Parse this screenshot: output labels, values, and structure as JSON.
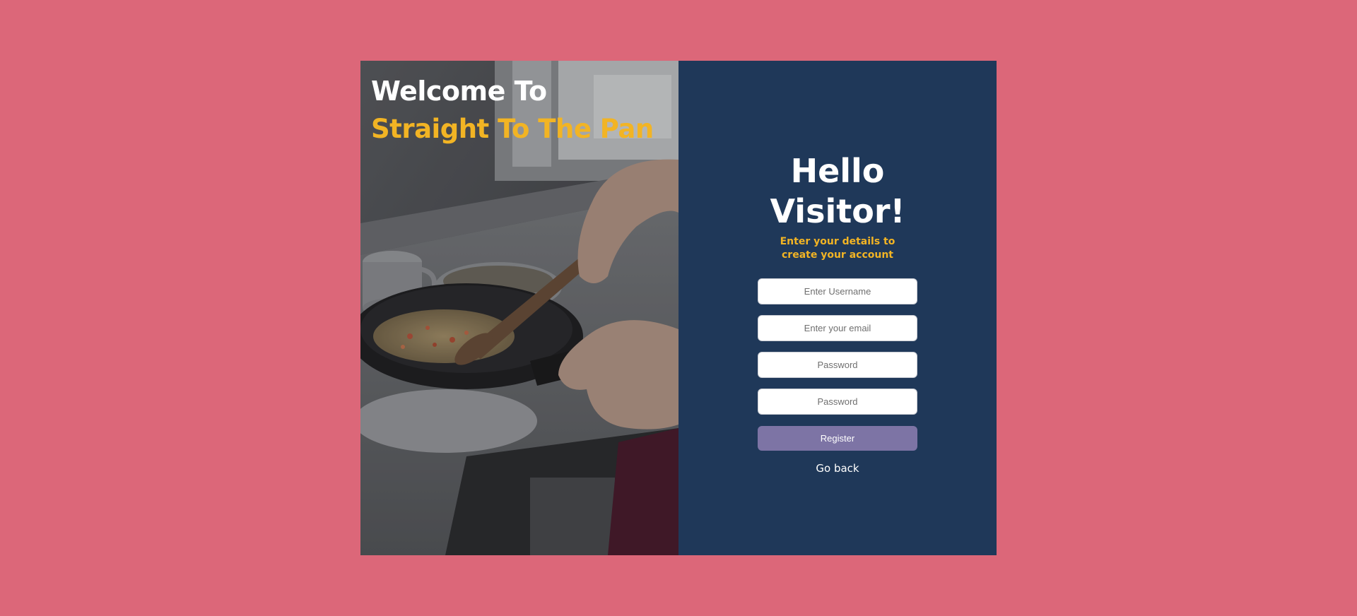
{
  "hero": {
    "welcome": "Welcome To",
    "brand": "Straight To The Pan",
    "image": "cooking-pan-photo"
  },
  "form": {
    "title": "Hello Visitor!",
    "subtitle": "Enter your details to create your account",
    "username_placeholder": "Enter Username",
    "email_placeholder": "Enter your email",
    "password_placeholder": "Password",
    "confirm_password_placeholder": "Password",
    "register_label": "Register",
    "back_label": "Go back"
  },
  "colors": {
    "background": "#dc6779",
    "panel": "#1f3859",
    "accent": "#f2b424",
    "button": "#7d74a5"
  }
}
